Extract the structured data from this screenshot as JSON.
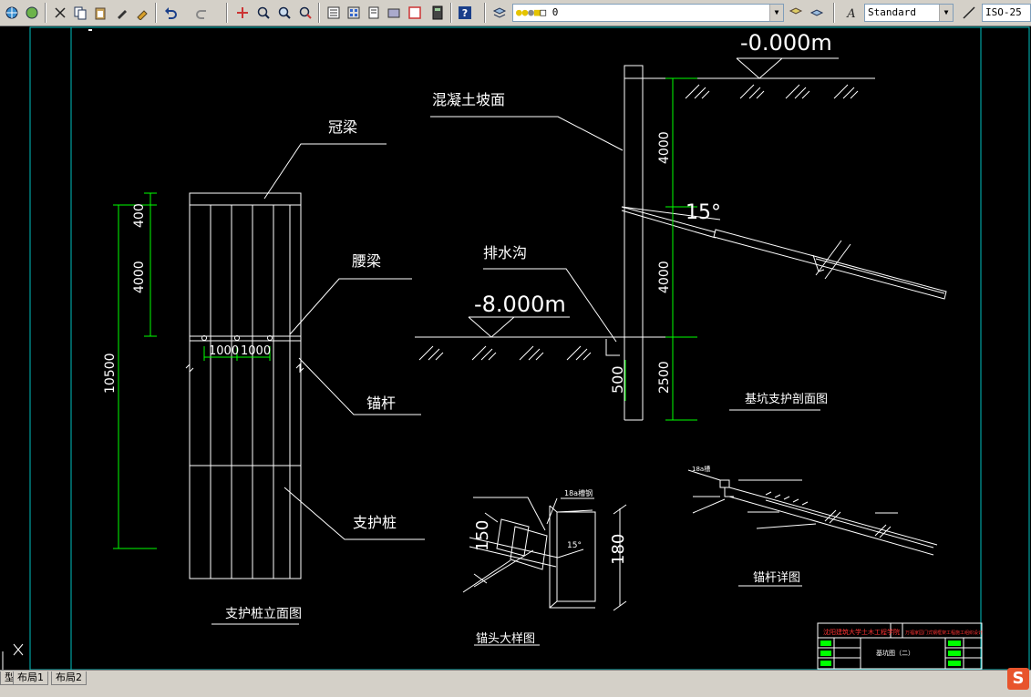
{
  "toolbar": {
    "icons": [
      "globe-icon",
      "world-icon",
      "cut-icon",
      "copy-icon",
      "paste-icon",
      "pen-icon",
      "match-prop-icon",
      "undo-icon",
      "redo-icon",
      "pan-icon",
      "zoom-realtime-icon",
      "zoom-window-icon",
      "zoom-previous-icon",
      "properties-icon",
      "design-center-icon",
      "tool-palette-icon",
      "sheet-set-icon",
      "markup-icon",
      "calculator-icon",
      "help-icon",
      "layer-manager-icon",
      "bulb-icon",
      "sun-icon",
      "freeze-icon",
      "lock-icon",
      "color-swatch-icon",
      "layer-prev-icon",
      "layer-state-icon",
      "text-style-icon",
      "dim-style-icon"
    ],
    "layer_value": "0",
    "text_style_value": "Standard",
    "dim_style_value": "ISO-25"
  },
  "drawing": {
    "labels": {
      "ground_elev": "-0.000m",
      "concrete_slope": "混凝土坡面",
      "crown_beam": "冠梁",
      "waist_beam": "腰梁",
      "anchor": "锚杆",
      "support_pile": "支护桩",
      "drain_ditch": "排水沟",
      "pit_elev": "-8.000m",
      "angle_15": "15°",
      "dim_400": "400",
      "dim_4000_a": "4000",
      "dim_10500": "10500",
      "dim_1000_a": "1000",
      "dim_1000_b": "1000",
      "dim_4000_b": "4000",
      "dim_4000_c": "4000",
      "dim_2500": "2500",
      "dim_500": "500",
      "dim_150": "150",
      "dim_180": "180",
      "title_pile_elev": "支护桩立面图",
      "title_section": "基坑支护剖面图",
      "title_anchor_head": "锚头大样图",
      "title_anchor_detail": "锚杆详图",
      "small_18a_a": "18a槽钢",
      "small_18a_b": "18a槽",
      "small_15": "15°",
      "tb_school": "沈阳建筑大学土木工程学院",
      "tb_project": "万福家园门式钢框架工程施工组织设计",
      "tb_drawing": "基坑图（二）"
    }
  },
  "tabs": [
    "型",
    "布局1",
    "布局2"
  ],
  "ime_label": "S"
}
